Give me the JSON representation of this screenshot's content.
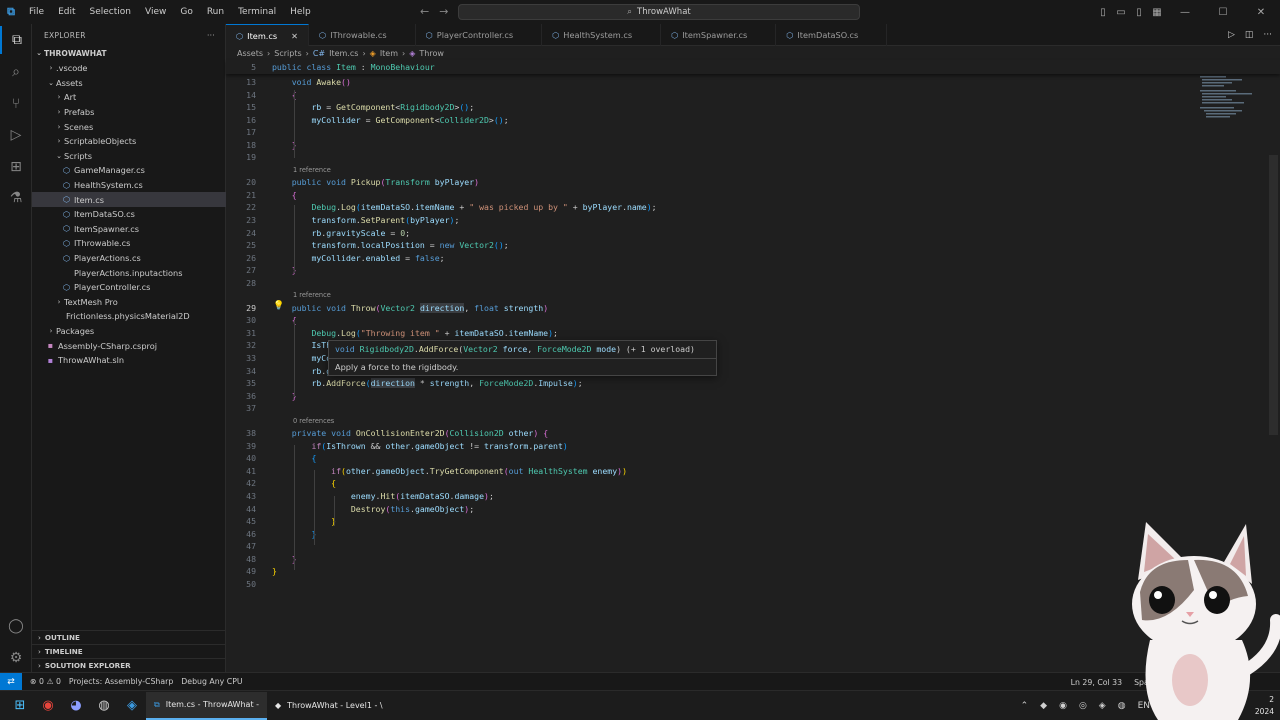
{
  "app": {
    "logo_text": "⧉",
    "window_title": "ThrowAWhat",
    "menu": [
      "File",
      "Edit",
      "Selection",
      "View",
      "Go",
      "Run",
      "Terminal",
      "Help"
    ]
  },
  "sidebar": {
    "title": "EXPLORER",
    "root": "THROWAWHAT",
    "tree": [
      {
        "label": ".vscode",
        "kind": "folder",
        "indent": 1,
        "open": false
      },
      {
        "label": "Assets",
        "kind": "folder",
        "indent": 1,
        "open": true
      },
      {
        "label": "Art",
        "kind": "folder",
        "indent": 2,
        "open": false
      },
      {
        "label": "Prefabs",
        "kind": "folder",
        "indent": 2,
        "open": false
      },
      {
        "label": "Scenes",
        "kind": "folder",
        "indent": 2,
        "open": false
      },
      {
        "label": "ScriptableObjects",
        "kind": "folder",
        "indent": 2,
        "open": false
      },
      {
        "label": "Scripts",
        "kind": "folder",
        "indent": 2,
        "open": true
      },
      {
        "label": "GameManager.cs",
        "kind": "cs",
        "indent": 3
      },
      {
        "label": "HealthSystem.cs",
        "kind": "cs",
        "indent": 3
      },
      {
        "label": "Item.cs",
        "kind": "cs",
        "indent": 3,
        "selected": true
      },
      {
        "label": "ItemDataSO.cs",
        "kind": "cs",
        "indent": 3
      },
      {
        "label": "ItemSpawner.cs",
        "kind": "cs",
        "indent": 3
      },
      {
        "label": "IThrowable.cs",
        "kind": "cs",
        "indent": 3
      },
      {
        "label": "PlayerActions.cs",
        "kind": "cs",
        "indent": 3
      },
      {
        "label": "PlayerActions.inputactions",
        "kind": "file",
        "indent": 3
      },
      {
        "label": "PlayerController.cs",
        "kind": "cs",
        "indent": 3
      },
      {
        "label": "TextMesh Pro",
        "kind": "folder",
        "indent": 2,
        "open": false
      },
      {
        "label": "Frictionless.physicsMaterial2D",
        "kind": "file",
        "indent": 2
      },
      {
        "label": "Packages",
        "kind": "folder",
        "indent": 1,
        "open": false
      },
      {
        "label": "Assembly-CSharp.csproj",
        "kind": "proj",
        "indent": 1
      },
      {
        "label": "ThrowAWhat.sln",
        "kind": "sln",
        "indent": 1
      }
    ],
    "sections": [
      "OUTLINE",
      "TIMELINE",
      "SOLUTION EXPLORER"
    ]
  },
  "tabs": [
    {
      "label": "Item.cs",
      "active": true
    },
    {
      "label": "IThrowable.cs"
    },
    {
      "label": "PlayerController.cs"
    },
    {
      "label": "HealthSystem.cs"
    },
    {
      "label": "ItemSpawner.cs"
    },
    {
      "label": "ItemDataSO.cs"
    }
  ],
  "breadcrumb": [
    "Assets",
    "Scripts",
    "Item.cs",
    "Item",
    "Throw"
  ],
  "editor": {
    "sticky_line": "5",
    "sticky_html": "<span class='kw'>public</span> <span class='kw'>class</span> <span class='ty'>Item</span> : <span class='ty'>MonoBehaviour</span>",
    "current_line": "29",
    "lines": [
      {
        "n": "13",
        "html": "    <span class='kw'>void</span> <span class='fn'>Awake</span><span class='brk2'>()</span>"
      },
      {
        "n": "14",
        "html": "    <span class='brk2'>{</span>"
      },
      {
        "n": "15",
        "html": "        <span class='var'>rb</span> = <span class='fn'>GetComponent</span>&lt;<span class='ty'>Rigidbody2D</span>&gt;<span class='brk3'>()</span>;"
      },
      {
        "n": "16",
        "html": "        <span class='var'>myCollider</span> = <span class='fn'>GetComponent</span>&lt;<span class='ty'>Collider2D</span>&gt;<span class='brk3'>()</span>;"
      },
      {
        "n": "17",
        "html": ""
      },
      {
        "n": "18",
        "html": "    <span class='brk2'>}</span>"
      },
      {
        "n": "19",
        "html": ""
      },
      {
        "n": "20",
        "lens": "1 reference",
        "html": "    <span class='kw'>public</span> <span class='kw'>void</span> <span class='fn'>Pickup</span><span class='brk2'>(</span><span class='ty'>Transform</span> <span class='var'>byPlayer</span><span class='brk2'>)</span>"
      },
      {
        "n": "21",
        "html": "    <span class='brk2'>{</span>"
      },
      {
        "n": "22",
        "html": "        <span class='ty'>Debug</span>.<span class='fn'>Log</span><span class='brk3'>(</span><span class='var'>itemDataSO</span>.<span class='var'>itemName</span> + <span class='str'>\" was picked up by \"</span> + <span class='var'>byPlayer</span>.<span class='var'>name</span><span class='brk3'>)</span>;"
      },
      {
        "n": "23",
        "html": "        <span class='var'>transform</span>.<span class='fn'>SetParent</span><span class='brk3'>(</span><span class='var'>byPlayer</span><span class='brk3'>)</span>;"
      },
      {
        "n": "24",
        "html": "        <span class='var'>rb</span>.<span class='var'>gravityScale</span> = <span class='num'>0</span>;"
      },
      {
        "n": "25",
        "html": "        <span class='var'>transform</span>.<span class='var'>localPosition</span> = <span class='kw'>new</span> <span class='ty'>Vector2</span><span class='brk3'>()</span>;"
      },
      {
        "n": "26",
        "html": "        <span class='var'>myCollider</span>.<span class='var'>enabled</span> = <span class='kw'>false</span>;"
      },
      {
        "n": "27",
        "html": "    <span class='brk2'>}</span>"
      },
      {
        "n": "28",
        "html": ""
      },
      {
        "n": "29",
        "lens": "1 reference",
        "html": "    <span class='kw'>public</span> <span class='kw'>void</span> <span class='fn'>Throw</span><span class='brk2'>(</span><span class='ty'>Vector2</span> <span class='var hl'>direction</span>, <span class='kw'>float</span> <span class='var'>strength</span><span class='brk2'>)</span>"
      },
      {
        "n": "30",
        "html": "    <span class='brk2'>{</span>"
      },
      {
        "n": "31",
        "html": "        <span class='ty'>Debug</span>.<span class='fn'>Log</span><span class='brk3'>(</span><span class='str'>\"Throwing item \"</span> + <span class='var'>itemDataSO</span>.<span class='var'>itemName</span><span class='brk3'>)</span>;"
      },
      {
        "n": "32",
        "html": "        <span class='var'>IsThrown</span> = <span class='kw'>true</span>;"
      },
      {
        "n": "33",
        "html": "        <span class='var'>myCollider</span>.<span class='var'>enabled</span> = <span class='kw'>true</span>;"
      },
      {
        "n": "34",
        "html": "        <span class='var'>rb</span>.<span class='var'>gravityScale</span> = <span class='num'>1</span>;"
      },
      {
        "n": "35",
        "html": "        <span class='var'>rb</span>.<span class='fn'>AddForce</span><span class='brk3'>(</span><span class='var hl'>direction</span> * <span class='var'>strength</span>, <span class='ty'>ForceMode2D</span>.<span class='var'>Impulse</span><span class='brk3'>)</span>;"
      },
      {
        "n": "36",
        "html": "    <span class='brk2'>}</span>"
      },
      {
        "n": "37",
        "html": ""
      },
      {
        "n": "38",
        "lens": "0 references",
        "html": "    <span class='kw'>private</span> <span class='kw'>void</span> <span class='fn'>OnCollisionEnter2D</span><span class='brk2'>(</span><span class='ty'>Collision2D</span> <span class='var'>other</span><span class='brk2'>)</span> <span class='brk2'>{</span>"
      },
      {
        "n": "39",
        "html": "        <span class='ctl'>if</span><span class='brk3'>(</span><span class='var'>IsThrown</span> &amp;&amp; <span class='var'>other</span>.<span class='var'>gameObject</span> != <span class='var'>transform</span>.<span class='var'>parent</span><span class='brk3'>)</span>"
      },
      {
        "n": "40",
        "html": "        <span class='brk3'>{</span>"
      },
      {
        "n": "41",
        "html": "            <span class='ctl'>if</span><span class='brk'>(</span><span class='var'>other</span>.<span class='var'>gameObject</span>.<span class='fn'>TryGetComponent</span><span class='brk2'>(</span><span class='kw'>out</span> <span class='ty'>HealthSystem</span> <span class='var'>enemy</span><span class='brk2'>)</span><span class='brk'>)</span>"
      },
      {
        "n": "42",
        "html": "            <span class='brk'>{</span>"
      },
      {
        "n": "43",
        "html": "                <span class='var'>enemy</span>.<span class='fn'>Hit</span><span class='brk2'>(</span><span class='var'>itemDataSO</span>.<span class='var'>damage</span><span class='brk2'>)</span>;"
      },
      {
        "n": "44",
        "html": "                <span class='fn'>Destroy</span><span class='brk2'>(</span><span class='kw'>this</span>.<span class='var'>gameObject</span><span class='brk2'>)</span>;"
      },
      {
        "n": "45",
        "html": "            <span class='brk'>}</span>"
      },
      {
        "n": "46",
        "html": "        <span class='brk3'>}</span>"
      },
      {
        "n": "47",
        "html": ""
      },
      {
        "n": "48",
        "html": "    <span class='brk2'>}</span>"
      },
      {
        "n": "49",
        "html": "<span class='brk'>}</span>"
      },
      {
        "n": "50",
        "html": ""
      }
    ],
    "hover": {
      "signature_html": "<span class='kw'>void</span> <span class='ty'>Rigidbody2D</span>.<span class='fn'>AddForce</span>(<span class='ty'>Vector2</span> <span class='var'>force</span>, <span class='ty'>ForceMode2D</span> <span class='var'>mode</span>) (+ 1 overload)",
      "doc": "Apply a force to the rigidbody."
    }
  },
  "status": {
    "errors": "0",
    "warnings": "0",
    "projects": "Projects: Assembly-CSharp",
    "config": "Debug Any CPU",
    "position": "Ln 29, Col 33",
    "spaces": "Spaces: 4"
  },
  "taskbar": {
    "apps": [
      {
        "label": "Item.cs - ThrowAWhat -",
        "active": true
      },
      {
        "label": "ThrowAWhat - Level1 - \\"
      }
    ],
    "lang": "EN",
    "clock_time": "2",
    "clock_date": "2024"
  },
  "colors": {
    "accent": "#0078d4",
    "background": "#1f1f1f"
  }
}
